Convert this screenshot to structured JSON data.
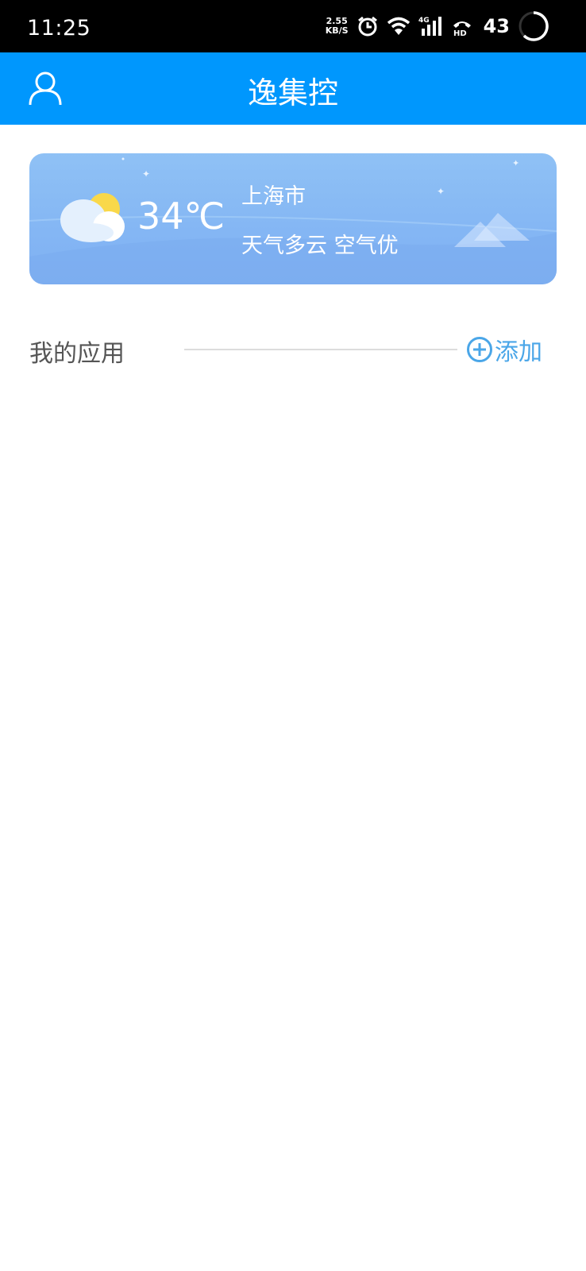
{
  "status_bar": {
    "time": "11:25",
    "net_speed_value": "2.55",
    "net_speed_unit": "KB/S",
    "battery": "43",
    "icons": [
      "alarm-icon",
      "wifi-icon",
      "signal-4g-icon",
      "hd-call-icon",
      "battery-ring-icon"
    ]
  },
  "app_bar": {
    "title": "逸集控",
    "profile_icon": "user-icon",
    "color": "#0097fd"
  },
  "weather": {
    "temperature": "34℃",
    "city": "上海市",
    "condition": "天气多云 空气优",
    "icon": "partly-cloudy-icon"
  },
  "my_apps": {
    "title": "我的应用",
    "add_label": "添加",
    "add_icon": "plus-circle-icon",
    "accent": "#4aa6e8"
  }
}
